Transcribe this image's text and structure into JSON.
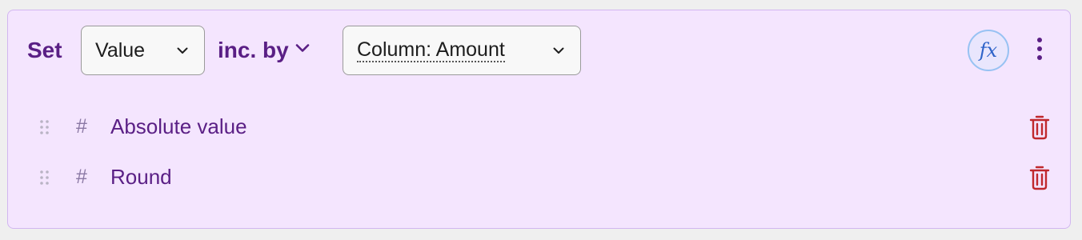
{
  "rule": {
    "set_label": "Set",
    "target_select": {
      "value": "Value"
    },
    "operator": {
      "label": "inc. by"
    },
    "source_select": {
      "value": "Column: Amount"
    },
    "formula_button": {
      "label": "fx"
    }
  },
  "transforms": [
    {
      "icon": "#",
      "label": "Absolute value"
    },
    {
      "icon": "#",
      "label": "Round"
    }
  ],
  "colors": {
    "card_background": "#f4e5fe",
    "card_border": "#d2b6f0",
    "accent_purple": "#5a1f85",
    "delete_red": "#c0282d",
    "fx_blue": "#2e63c9"
  },
  "icons": {
    "chevron": "chevron-down-icon",
    "more": "more-vertical-icon",
    "drag": "drag-handle-icon",
    "delete": "trash-icon"
  }
}
